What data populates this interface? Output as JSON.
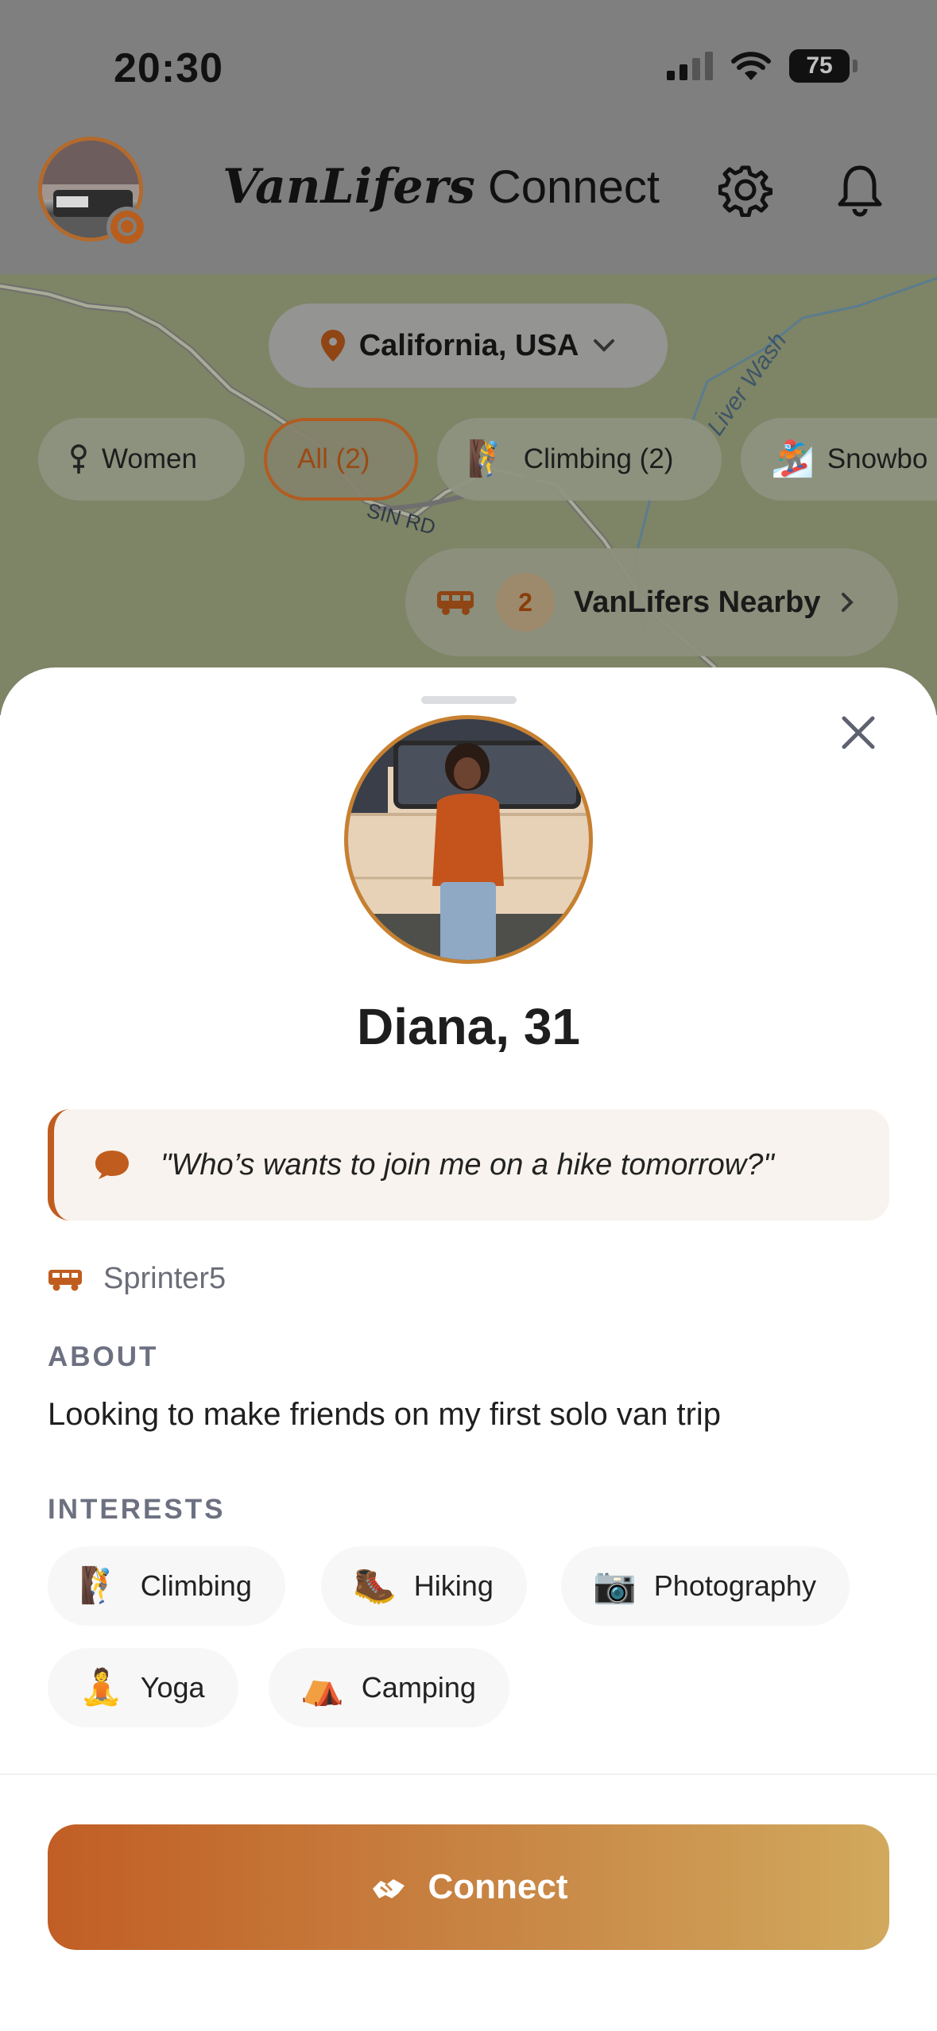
{
  "status_bar": {
    "time": "20:30",
    "battery": "75"
  },
  "header": {
    "title_brand": "VanLifers",
    "title_suffix": "Connect",
    "settings_icon": "gear-icon",
    "notifications_icon": "bell-icon"
  },
  "location": {
    "label": "California, USA"
  },
  "map_labels": {
    "road": "SIN RD",
    "wash": "Liver Wash"
  },
  "filters": [
    {
      "icon": "female-symbol-icon",
      "label": "Women",
      "active": false
    },
    {
      "label": "All (2)",
      "active": true
    },
    {
      "icon": "climbing-icon",
      "label": "Climbing (2)",
      "active": false
    },
    {
      "icon": "snowboard-icon",
      "label": "Snowbo",
      "active": false
    }
  ],
  "nearby": {
    "count": "2",
    "label": "VanLifers Nearby"
  },
  "profile": {
    "name": "Diana, 31",
    "quote": "\"Who’s wants to join me on a hike tomorrow?\"",
    "van": "Sprinter5",
    "about_heading": "ABOUT",
    "about": "Looking to make friends on my first solo van trip",
    "interests_heading": "INTERESTS",
    "interests": [
      {
        "emoji": "🧗",
        "label": "Climbing"
      },
      {
        "emoji": "🥾",
        "label": "Hiking"
      },
      {
        "emoji": "📷",
        "label": "Photography"
      },
      {
        "emoji": "🧘",
        "label": "Yoga"
      },
      {
        "emoji": "⛺",
        "label": "Camping"
      }
    ]
  },
  "actions": {
    "connect_label": "Connect"
  },
  "colors": {
    "accent": "#c05d1e",
    "accent_light": "#d1a95d",
    "quote_bg": "#f8f3ee"
  }
}
